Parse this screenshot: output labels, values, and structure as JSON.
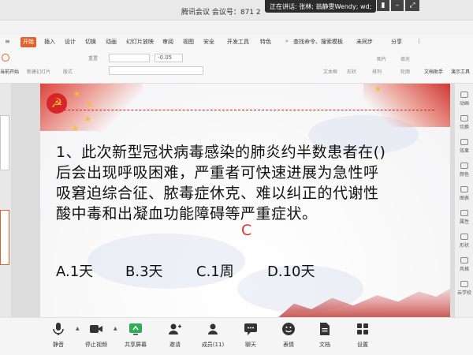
{
  "titlebar": {
    "title": "腾讯会议 会议号：871 2",
    "speaking": "正在讲话: 张林; 翁静雯Wendy; wd;"
  },
  "menu": {
    "start": "开始",
    "items": [
      "插入",
      "设计",
      "切换",
      "动画",
      "幻灯片放映",
      "审阅",
      "视图",
      "安全",
      "开发工具",
      "特色"
    ],
    "search": "查找命令、搜索模板",
    "sync": "未同步",
    "share": "分享"
  },
  "ribbon": {
    "new_slide": "新建幻灯片",
    "play_label": "当前开始",
    "reset": "重置",
    "layout": "版式",
    "font_size": "-0.05",
    "textbox": "文本框",
    "shape": "形状",
    "arrange": "排列",
    "image": "图片",
    "fill": "填充",
    "outline": "轮廓",
    "doc_assist": "文档助手",
    "presenter": "演示工具"
  },
  "right_panel": [
    "动画",
    "切换",
    "效果",
    "颜色",
    "图表",
    "属性",
    "形状",
    "风格",
    "云学校"
  ],
  "slide": {
    "question": "1、此次新型冠状病毒感染的肺炎约半数患者在()后会出现呼吸困难，严重者可快速进展为急性呼吸窘迫综合征、脓毒症休克、难以纠正的代谢性酸中毒和出凝血功能障碍等严重症状。",
    "answer": "C",
    "options": [
      "A.1天",
      "B.3天",
      "C.1周",
      "D.10天"
    ],
    "colors": {
      "accent_red": "#d21c1c",
      "answer_red": "#e03030",
      "flag_red": "#d8252a",
      "star_gold": "#f2c12e"
    }
  },
  "toolbar": {
    "mute": "静音",
    "video": "停止视频",
    "share": "共享屏幕",
    "invite": "邀请",
    "members": "成员(11)",
    "chat": "聊天",
    "reaction": "表情",
    "docs": "文档",
    "settings": "设置",
    "share_color": "#2fae54"
  }
}
